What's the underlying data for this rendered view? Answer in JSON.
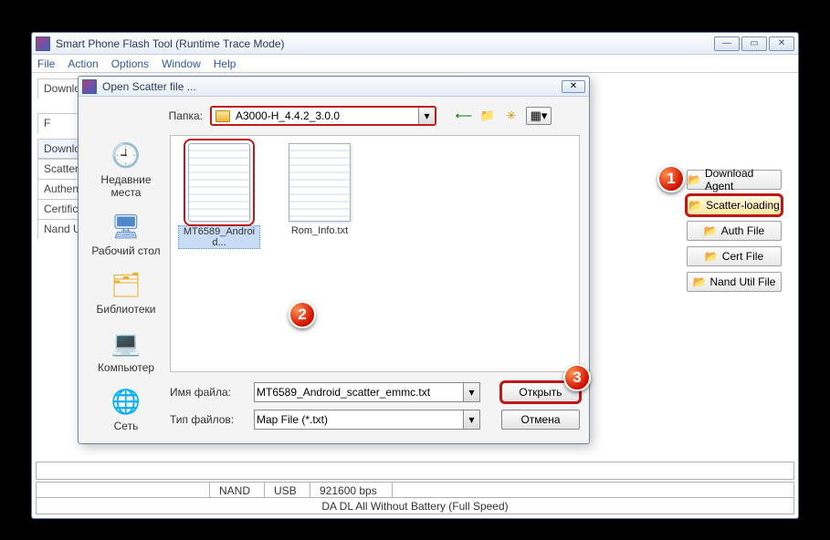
{
  "main": {
    "title": "Smart Phone Flash Tool (Runtime Trace Mode)",
    "menu": [
      "File",
      "Action",
      "Options",
      "Window",
      "Help"
    ],
    "tabs": [
      "Downlo",
      "F",
      "Downlo",
      "Scatter-l",
      "Authenti",
      "Certifica",
      "Nand Uti"
    ],
    "right_buttons": {
      "download_agent": "Download Agent",
      "scatter_loading": "Scatter-loading",
      "auth_file": "Auth File",
      "cert_file": "Cert File",
      "nand_util": "Nand Util File"
    },
    "status": {
      "nand": "NAND",
      "usb": "USB",
      "baud": "921600 bps",
      "mode": "DA DL All Without Battery (Full Speed)"
    }
  },
  "dialog": {
    "title": "Open Scatter file ...",
    "folder_label": "Папка:",
    "folder_value": "A3000-H_4.4.2_3.0.0",
    "places": {
      "recent": "Недавние места",
      "desktop": "Рабочий стол",
      "libraries": "Библиотеки",
      "computer": "Компьютер",
      "network": "Сеть"
    },
    "files": [
      {
        "name": "MT6589_Android...",
        "selected": true
      },
      {
        "name": "Rom_Info.txt",
        "selected": false
      }
    ],
    "file_name_label": "Имя файла:",
    "file_name_value": "MT6589_Android_scatter_emmc.txt",
    "file_type_label": "Тип файлов:",
    "file_type_value": "Map File (*.txt)",
    "open": "Открыть",
    "cancel": "Отмена"
  },
  "badges": {
    "b1": "1",
    "b2": "2",
    "b3": "3"
  }
}
